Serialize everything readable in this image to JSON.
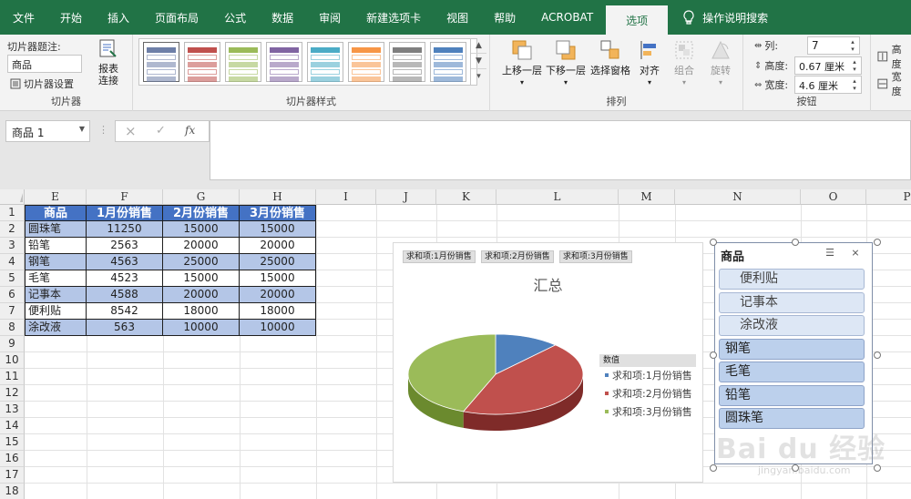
{
  "tabs": [
    {
      "label": "文件"
    },
    {
      "label": "开始"
    },
    {
      "label": "插入"
    },
    {
      "label": "页面布局"
    },
    {
      "label": "公式"
    },
    {
      "label": "数据"
    },
    {
      "label": "审阅"
    },
    {
      "label": "新建选项卡"
    },
    {
      "label": "视图"
    },
    {
      "label": "帮助"
    },
    {
      "label": "ACROBAT"
    }
  ],
  "active_tab": "选项",
  "tell_me": "操作说明搜索",
  "ribbon": {
    "slicer_group": {
      "caption_label": "切片器题注:",
      "caption_value": "商品",
      "settings_label": "切片器设置",
      "report_label": "报表",
      "report_label2": "连接",
      "group_label": "切片器"
    },
    "styles_group": {
      "group_label": "切片器样式"
    },
    "arrange_group": {
      "bring_forward": "上移一层",
      "send_backward": "下移一层",
      "selection_pane": "选择窗格",
      "align": "对齐",
      "group": "组合",
      "rotate": "旋转",
      "group_label": "排列"
    },
    "buttons_group": {
      "columns_label": "列:",
      "columns_value": "7",
      "height_label": "高度:",
      "height_value": "0.67 厘米",
      "width_label": "宽度:",
      "width_value": "4.6 厘米",
      "group_label": "按钮"
    },
    "size_group": {
      "height_label": "高度",
      "width_label": "宽度"
    },
    "style_colors": [
      "#6e7fa8",
      "#c0504d",
      "#9bbb59",
      "#8064a2",
      "#4bacc6",
      "#f79646",
      "#7f7f7f",
      "#4f81bd"
    ]
  },
  "formula_bar": {
    "name_box": "商品 1",
    "cancel_icon": "×",
    "enter_icon": "✓",
    "fx_label": "fx"
  },
  "grid": {
    "columns": [
      "E",
      "F",
      "G",
      "H",
      "I",
      "J",
      "K",
      "L",
      "M",
      "N",
      "O",
      "P"
    ],
    "rows": [
      "1",
      "2",
      "3",
      "4",
      "5",
      "6",
      "7",
      "8",
      "9",
      "10",
      "11",
      "12",
      "13",
      "14",
      "15",
      "16",
      "17",
      "18"
    ]
  },
  "table": {
    "headers": [
      "商品",
      "1月份销售",
      "2月份销售",
      "3月份销售"
    ],
    "rows": [
      [
        "圆珠笔",
        "11250",
        "15000",
        "15000"
      ],
      [
        "铅笔",
        "2563",
        "20000",
        "20000"
      ],
      [
        "钢笔",
        "4563",
        "25000",
        "25000"
      ],
      [
        "毛笔",
        "4523",
        "15000",
        "15000"
      ],
      [
        "记事本",
        "4588",
        "20000",
        "20000"
      ],
      [
        "便利贴",
        "8542",
        "18000",
        "18000"
      ],
      [
        "涂改液",
        "563",
        "10000",
        "10000"
      ]
    ]
  },
  "chart": {
    "field_buttons": [
      "求和项:1月份销售",
      "求和项:2月份销售",
      "求和项:3月份销售"
    ],
    "title": "汇总",
    "legend_title": "数值",
    "colors": [
      "#4f81bd",
      "#c0504d",
      "#9bbb59"
    ]
  },
  "chart_data": {
    "type": "pie",
    "title": "汇总",
    "categories": [
      "求和项:1月份销售",
      "求和项:2月份销售",
      "求和项:3月份销售"
    ],
    "values": [
      0.12,
      0.44,
      0.44
    ],
    "legend_placement": "right"
  },
  "slicer": {
    "title": "商品",
    "items": [
      {
        "label": "便利贴",
        "has_data": false
      },
      {
        "label": "记事本",
        "has_data": false
      },
      {
        "label": "涂改液",
        "has_data": false
      },
      {
        "label": "钢笔",
        "has_data": true
      },
      {
        "label": "毛笔",
        "has_data": true
      },
      {
        "label": "铅笔",
        "has_data": true
      },
      {
        "label": "圆珠笔",
        "has_data": true
      }
    ]
  },
  "watermark": {
    "text": "Bai du 经验",
    "sub": "jingyan.baidu.com"
  }
}
